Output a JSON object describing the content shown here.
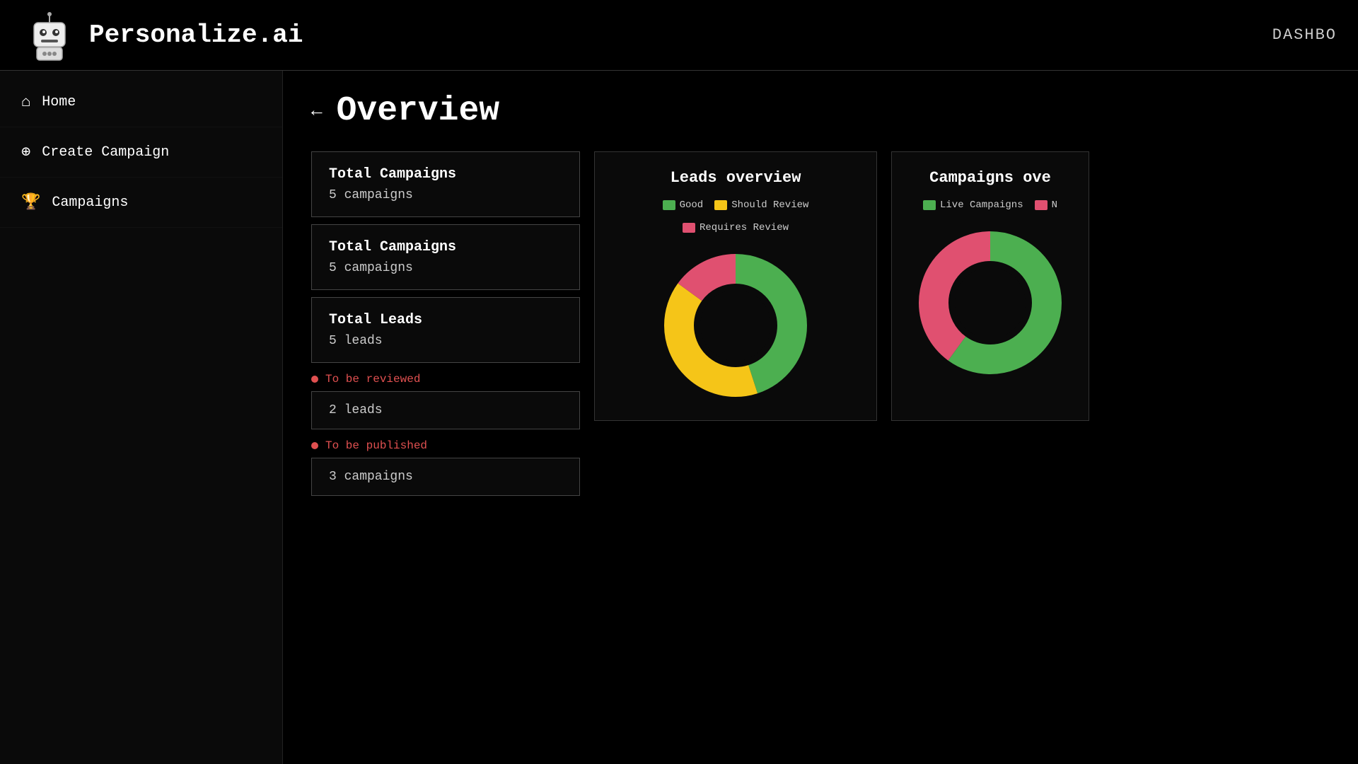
{
  "header": {
    "logo_text": "Personalize.ai",
    "nav_text": "DASHBO"
  },
  "sidebar": {
    "items": [
      {
        "id": "home",
        "icon": "⌂",
        "label": "Home"
      },
      {
        "id": "create-campaign",
        "icon": "⊕",
        "label": "Create Campaign"
      },
      {
        "id": "campaigns",
        "icon": "🏆",
        "label": "Campaigns"
      }
    ]
  },
  "page": {
    "title": "Overview",
    "back_label": "←"
  },
  "stats": {
    "total_campaigns_1": {
      "title": "Total Campaigns",
      "value": "5 campaigns"
    },
    "total_campaigns_2": {
      "title": "Total Campaigns",
      "value": "5 campaigns"
    },
    "total_leads": {
      "title": "Total Leads",
      "value": "5 leads"
    },
    "to_be_reviewed_label": "To be reviewed",
    "to_be_reviewed_value": "2 leads",
    "to_be_published_label": "To be published",
    "to_be_published_value": "3 campaigns"
  },
  "leads_chart": {
    "title": "Leads overview",
    "legend": [
      {
        "color": "#4caf50",
        "label": "Good"
      },
      {
        "color": "#f5c518",
        "label": "Should Review"
      },
      {
        "color": "#e05070",
        "label": "Requires Review"
      }
    ],
    "segments": [
      {
        "color": "#4caf50",
        "percent": 45
      },
      {
        "color": "#f5c518",
        "percent": 40
      },
      {
        "color": "#e05070",
        "percent": 15
      }
    ]
  },
  "campaigns_chart": {
    "title": "Campaigns ove",
    "legend": [
      {
        "color": "#4caf50",
        "label": "Live Campaigns"
      },
      {
        "color": "#e05070",
        "label": "N"
      }
    ],
    "segments": [
      {
        "color": "#4caf50",
        "percent": 60
      },
      {
        "color": "#e05070",
        "percent": 40
      }
    ]
  }
}
